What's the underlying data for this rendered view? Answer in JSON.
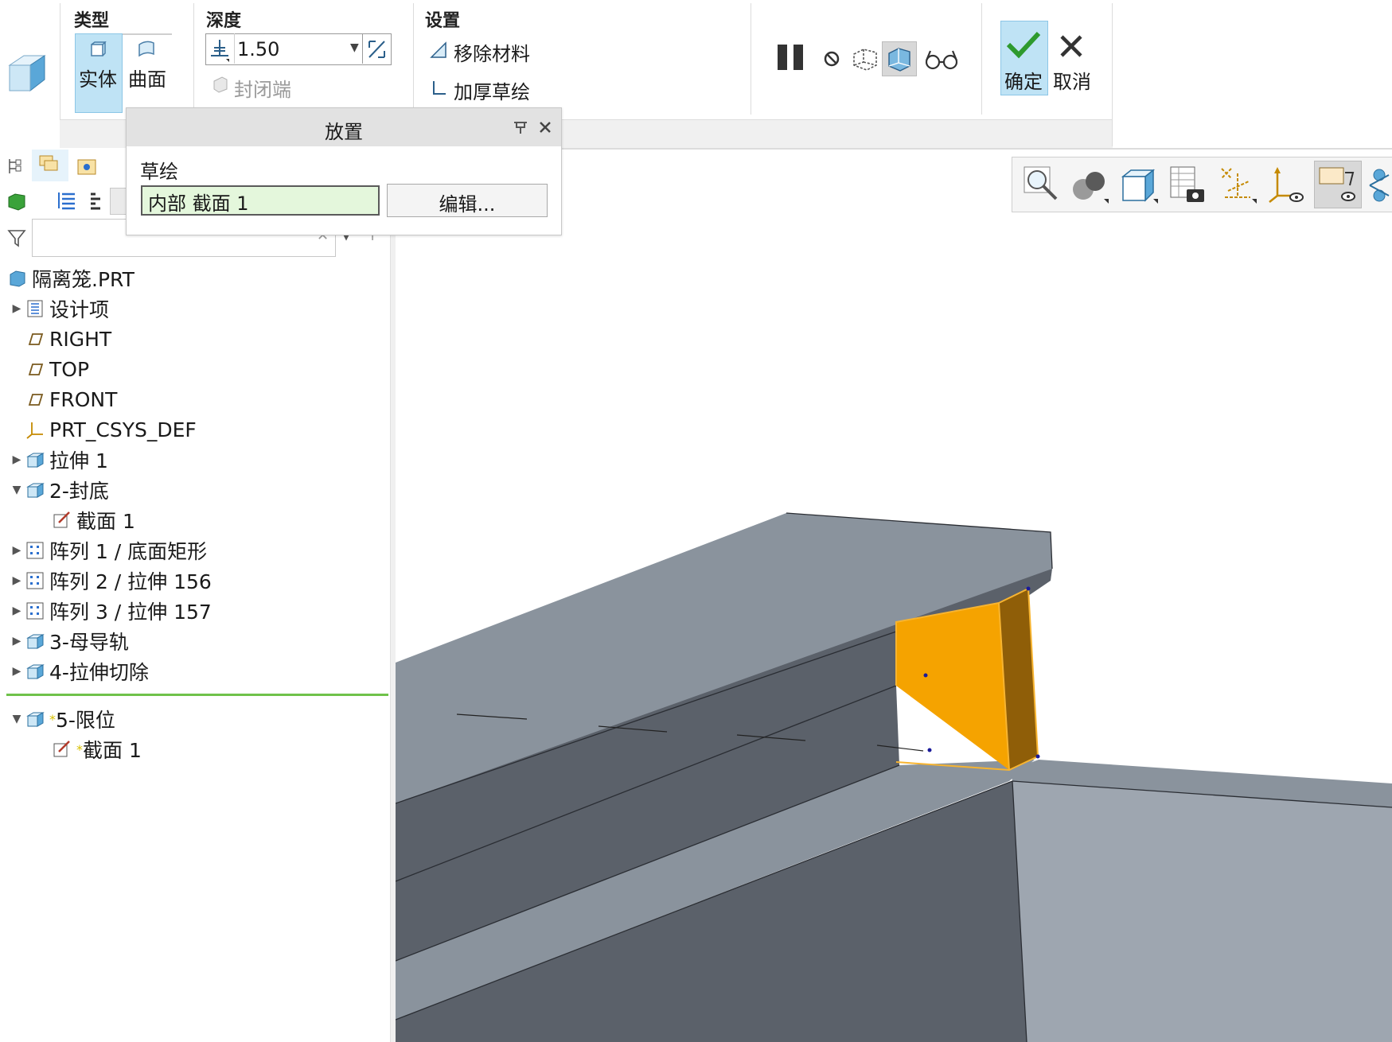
{
  "ribbon": {
    "type_group": {
      "title": "类型",
      "solid": "实体",
      "surface": "曲面"
    },
    "depth_group": {
      "title": "深度",
      "value": "1.50",
      "close_ends": "封闭端"
    },
    "settings_group": {
      "title": "设置",
      "remove_material": "移除材料",
      "thicken_sketch": "加厚草绘"
    },
    "confirm": "确定",
    "cancel": "取消"
  },
  "placement_panel": {
    "title": "放置",
    "sketch_label": "草绘",
    "sketch_value": "内部 截面 1",
    "edit_button": "编辑..."
  },
  "model_tree": {
    "filter_placeholder": "",
    "items": [
      {
        "label": "隔离笼.PRT",
        "icon": "part-icon",
        "expander": "none"
      },
      {
        "label": "设计项",
        "icon": "design-items-icon",
        "expander": "collapsed"
      },
      {
        "label": "RIGHT",
        "icon": "datum-plane-icon",
        "expander": "none"
      },
      {
        "label": "TOP",
        "icon": "datum-plane-icon",
        "expander": "none"
      },
      {
        "label": "FRONT",
        "icon": "datum-plane-icon",
        "expander": "none"
      },
      {
        "label": "PRT_CSYS_DEF",
        "icon": "csys-icon",
        "expander": "none"
      },
      {
        "label": "拉伸 1",
        "icon": "extrude-icon",
        "expander": "collapsed"
      },
      {
        "label": "2-封底",
        "icon": "extrude-icon",
        "expander": "expanded"
      },
      {
        "label": "截面 1",
        "icon": "sketch-icon",
        "expander": "none"
      },
      {
        "label": "阵列 1 / 底面矩形",
        "icon": "pattern-icon",
        "expander": "collapsed"
      },
      {
        "label": "阵列 2 / 拉伸 156",
        "icon": "pattern-icon",
        "expander": "collapsed"
      },
      {
        "label": "阵列 3 / 拉伸 157",
        "icon": "pattern-icon",
        "expander": "collapsed"
      },
      {
        "label": "3-母导轨",
        "icon": "extrude-icon",
        "expander": "collapsed"
      },
      {
        "label": "4-拉伸切除",
        "icon": "extrude-icon",
        "expander": "collapsed"
      }
    ],
    "new_items": [
      {
        "label": "5-限位",
        "icon": "extrude-icon",
        "expander": "expanded",
        "marker": "*"
      },
      {
        "label": "截面 1",
        "icon": "sketch-icon",
        "expander": "none",
        "marker": "*"
      }
    ]
  },
  "colors": {
    "selection": "#bfe3f5",
    "highlight_feature": "#f5a300",
    "model_gray": "#8a939d",
    "model_dark": "#5b616a",
    "insert_line": "#6fc24a"
  }
}
